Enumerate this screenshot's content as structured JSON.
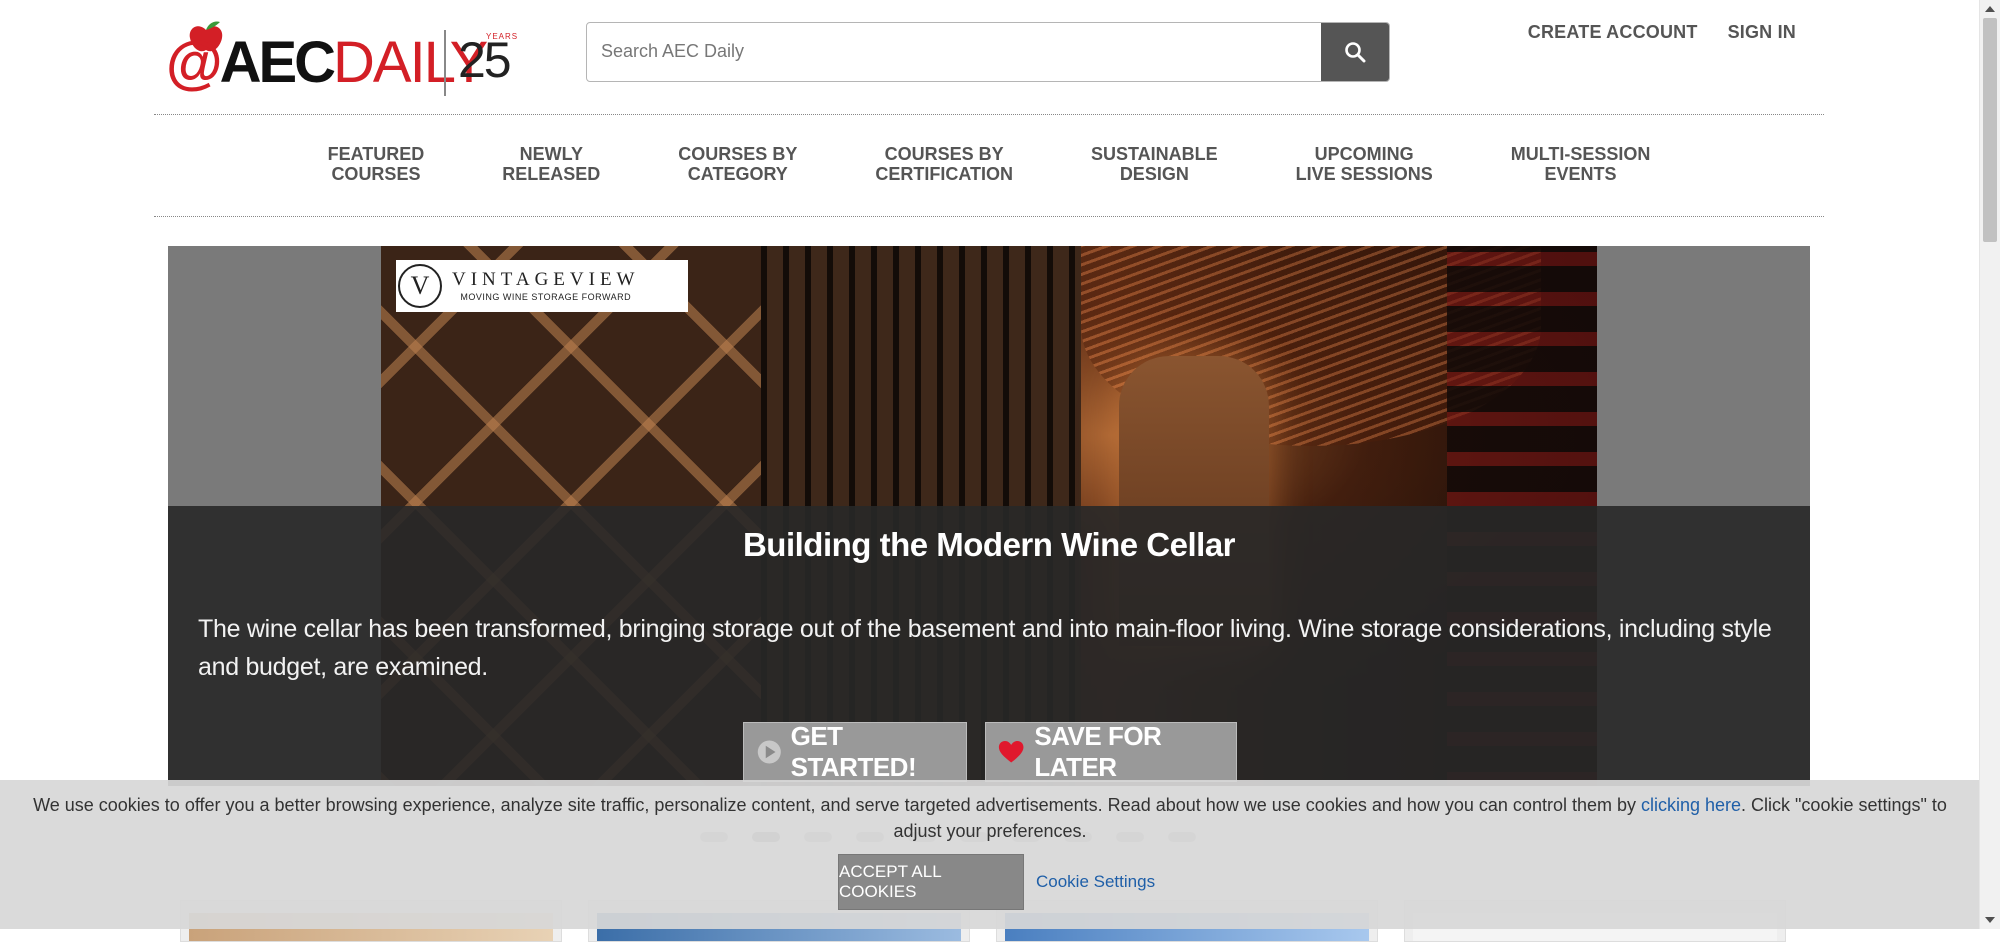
{
  "header": {
    "logo": {
      "at": "@",
      "aec": "AEC",
      "daily": "DAILY",
      "anniversary_number": "25",
      "anniversary_label": "YEARS"
    },
    "search": {
      "placeholder": "Search AEC Daily",
      "icon": "search-icon"
    },
    "links": {
      "create_account": "CREATE ACCOUNT",
      "sign_in": "SIGN IN"
    }
  },
  "nav": {
    "items": [
      {
        "line1": "FEATURED",
        "line2": "COURSES"
      },
      {
        "line1": "NEWLY",
        "line2": "RELEASED"
      },
      {
        "line1": "COURSES BY",
        "line2": "CATEGORY"
      },
      {
        "line1": "COURSES BY",
        "line2": "CERTIFICATION"
      },
      {
        "line1": "SUSTAINABLE",
        "line2": "DESIGN"
      },
      {
        "line1": "UPCOMING",
        "line2": "LIVE SESSIONS"
      },
      {
        "line1": "MULTI-SESSION",
        "line2": "EVENTS"
      }
    ]
  },
  "hero": {
    "sponsor": {
      "letter": "V",
      "name": "VINTAGEVIEW",
      "tagline": "MOVING WINE STORAGE FORWARD"
    },
    "title": "Building the Modern Wine Cellar",
    "description": "The wine cellar has been transformed, bringing storage out of the basement and into main-floor living. Wine storage considerations, including style and budget, are examined.",
    "get_started_label": "GET STARTED!",
    "save_label": "SAVE FOR LATER"
  },
  "cookie_banner": {
    "icon_glyph": "",
    "text_before": "We use cookies to offer you a better browsing experience, analyze site traffic, personalize content, and serve targeted advertisements. Read about how we use cookies and how you can control them by ",
    "link_text": "clicking here",
    "text_after": ". Click \"cookie settings\" to adjust your preferences.",
    "accept_label": "ACCEPT ALL COOKIES",
    "settings_label": "Cookie Settings"
  },
  "colors": {
    "brand_red": "#d31f26",
    "nav_text": "#555555",
    "caption_bg": "#282828",
    "link_blue": "#1f5fa8"
  }
}
